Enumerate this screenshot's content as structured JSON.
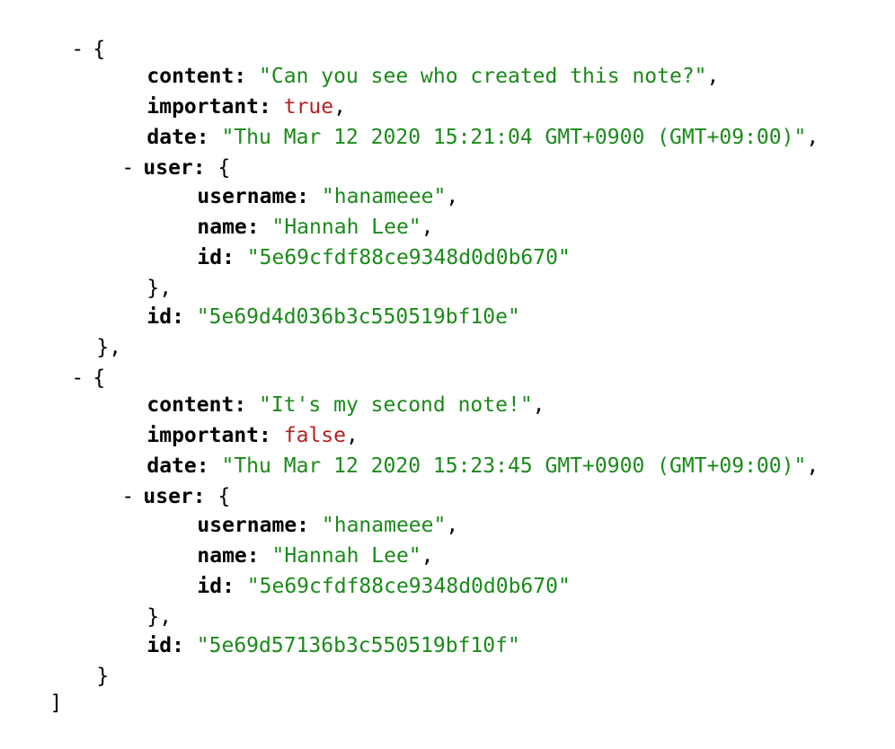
{
  "viewer": {
    "colors": {
      "string": "#1a8a1a",
      "boolean": "#b22222",
      "key": "#000000"
    },
    "toggle_symbol": "-",
    "notes": [
      {
        "content_key": "content",
        "content": "\"Can you see who created this note?\"",
        "important_key": "important",
        "important": "true",
        "date_key": "date",
        "date": "\"Thu Mar 12 2020 15:21:04 GMT+0900 (GMT+09:00)\"",
        "user_key": "user",
        "user": {
          "username_key": "username",
          "username": "\"hanameee\"",
          "name_key": "name",
          "name": "\"Hannah Lee\"",
          "id_key": "id",
          "id": "\"5e69cfdf88ce9348d0d0b670\""
        },
        "id_key": "id",
        "id": "\"5e69d4d036b3c550519bf10e\""
      },
      {
        "content_key": "content",
        "content": "\"It's my second note!\"",
        "important_key": "important",
        "important": "false",
        "date_key": "date",
        "date": "\"Thu Mar 12 2020 15:23:45 GMT+0900 (GMT+09:00)\"",
        "user_key": "user",
        "user": {
          "username_key": "username",
          "username": "\"hanameee\"",
          "name_key": "name",
          "name": "\"Hannah Lee\"",
          "id_key": "id",
          "id": "\"5e69cfdf88ce9348d0d0b670\""
        },
        "id_key": "id",
        "id": "\"5e69d57136b3c550519bf10f\""
      }
    ]
  }
}
